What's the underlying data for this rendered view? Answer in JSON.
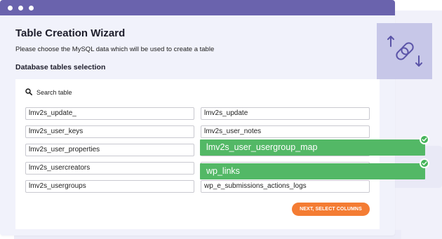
{
  "window": {
    "title": "Table Creation Wizard",
    "description": "Please choose the MySQL data which will be used to create a table",
    "section_title": "Database tables selection"
  },
  "search": {
    "placeholder": "Search table",
    "icon": "search-icon"
  },
  "tables": [
    "lmv2s_update_",
    "lmv2s_update",
    "lmv2s_user_keys",
    "lmv2s_user_notes",
    "lmv2s_user_properties",
    "lmv2s_user_usergroup_map",
    "lmv2s_usercreators",
    "wp_links",
    "lmv2s_usergroups",
    "wp_e_submissions_actions_logs"
  ],
  "selected_tables": [
    "lmv2s_user_usergroup_map",
    "wp_links"
  ],
  "next_button": "NEXT, SELECT COLUMNS",
  "colors": {
    "titlebar": "#6a63ad",
    "accent_orange": "#f47c33",
    "selected_green": "#53b866",
    "icon_box": "#c7c7e8",
    "icon_stroke": "#5b54a8"
  },
  "icons": [
    "link-transfer-icon",
    "check-icon"
  ]
}
